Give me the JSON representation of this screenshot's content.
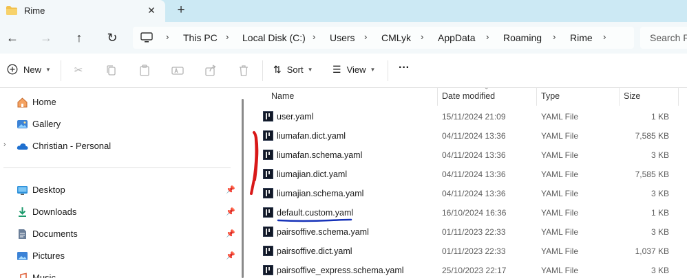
{
  "tab": {
    "title": "Rime",
    "close_glyph": "✕",
    "new_tab_glyph": "+"
  },
  "nav": {
    "back_glyph": "←",
    "forward_glyph": "→",
    "up_glyph": "↑",
    "refresh_glyph": "↻"
  },
  "breadcrumb": {
    "separator": "›",
    "items": [
      "This PC",
      "Local Disk (C:)",
      "Users",
      "CMLyk",
      "AppData",
      "Roaming",
      "Rime"
    ]
  },
  "search": {
    "placeholder": "Search R"
  },
  "commandbar": {
    "new_label": "New",
    "sort_label": "Sort",
    "view_label": "View",
    "more_glyph": "···"
  },
  "navpane": {
    "items": [
      {
        "label": "Home",
        "icon": "home-icon"
      },
      {
        "label": "Gallery",
        "icon": "gallery-icon"
      },
      {
        "label": "Christian - Personal",
        "icon": "onedrive-cloud-icon"
      }
    ],
    "pinned": [
      {
        "label": "Desktop",
        "icon": "desktop-folder-icon"
      },
      {
        "label": "Downloads",
        "icon": "downloads-folder-icon"
      },
      {
        "label": "Documents",
        "icon": "documents-folder-icon"
      },
      {
        "label": "Pictures",
        "icon": "pictures-folder-icon"
      },
      {
        "label": "Music",
        "icon": "music-folder-icon"
      }
    ],
    "pin_glyph": "📌"
  },
  "filelist": {
    "columns": {
      "name": "Name",
      "date": "Date modified",
      "type": "Type",
      "size": "Size"
    },
    "rows": [
      {
        "name": "user.yaml",
        "date": "15/11/2024 21:09",
        "type": "YAML File",
        "size": "1 KB"
      },
      {
        "name": "liumafan.dict.yaml",
        "date": "04/11/2024 13:36",
        "type": "YAML File",
        "size": "7,585 KB"
      },
      {
        "name": "liumafan.schema.yaml",
        "date": "04/11/2024 13:36",
        "type": "YAML File",
        "size": "3 KB"
      },
      {
        "name": "liumajian.dict.yaml",
        "date": "04/11/2024 13:36",
        "type": "YAML File",
        "size": "7,585 KB"
      },
      {
        "name": "liumajian.schema.yaml",
        "date": "04/11/2024 13:36",
        "type": "YAML File",
        "size": "3 KB"
      },
      {
        "name": "default.custom.yaml",
        "date": "16/10/2024 16:36",
        "type": "YAML File",
        "size": "1 KB"
      },
      {
        "name": "pairsoffive.schema.yaml",
        "date": "01/11/2023 22:33",
        "type": "YAML File",
        "size": "3 KB"
      },
      {
        "name": "pairsoffive.dict.yaml",
        "date": "01/11/2023 22:33",
        "type": "YAML File",
        "size": "1,037 KB"
      },
      {
        "name": "pairsoffive_express.schema.yaml",
        "date": "25/10/2023 22:17",
        "type": "YAML File",
        "size": "3 KB"
      }
    ]
  },
  "colors": {
    "tabbar": "#cce9f4",
    "annotation_red": "#d81818",
    "annotation_blue": "#1531b8"
  }
}
